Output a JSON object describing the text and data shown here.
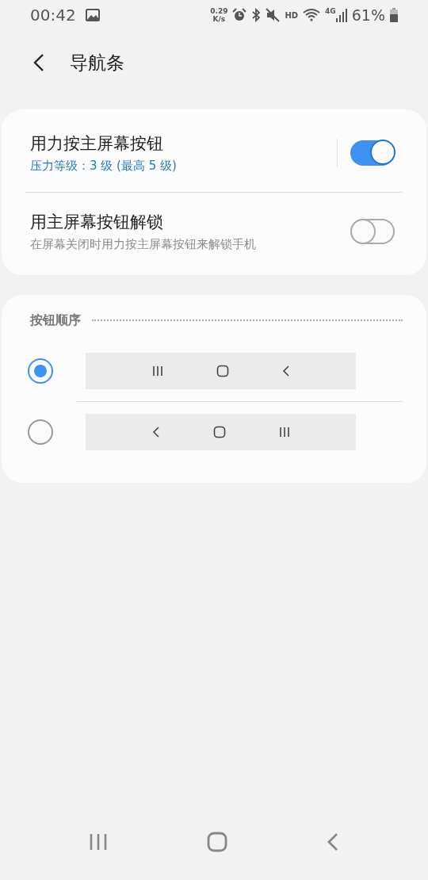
{
  "status_bar": {
    "time": "00:42",
    "speed": "0.29",
    "speed_unit": "K/s",
    "hd": "HD",
    "network": "4G",
    "battery": "61%"
  },
  "header": {
    "title": "导航条"
  },
  "settings": [
    {
      "title": "用力按主屏幕按钮",
      "subtitle": "压力等级：3 级 (最高 5 级)",
      "kind": "value",
      "on": true
    },
    {
      "title": "用主屏幕按钮解锁",
      "subtitle": "在屏幕关闭时用力按主屏幕按钮来解锁手机",
      "kind": "description",
      "on": false
    }
  ],
  "button_order": {
    "title": "按钮顺序",
    "options": [
      {
        "selected": true,
        "buttons": [
          {
            "kind": "recents"
          },
          {
            "kind": "home"
          },
          {
            "kind": "back"
          }
        ]
      },
      {
        "selected": false,
        "buttons": [
          {
            "kind": "back"
          },
          {
            "kind": "home"
          },
          {
            "kind": "recents"
          }
        ]
      }
    ]
  },
  "nav_bar": {
    "buttons": [
      {
        "kind": "recents"
      },
      {
        "kind": "home"
      },
      {
        "kind": "back"
      }
    ]
  }
}
